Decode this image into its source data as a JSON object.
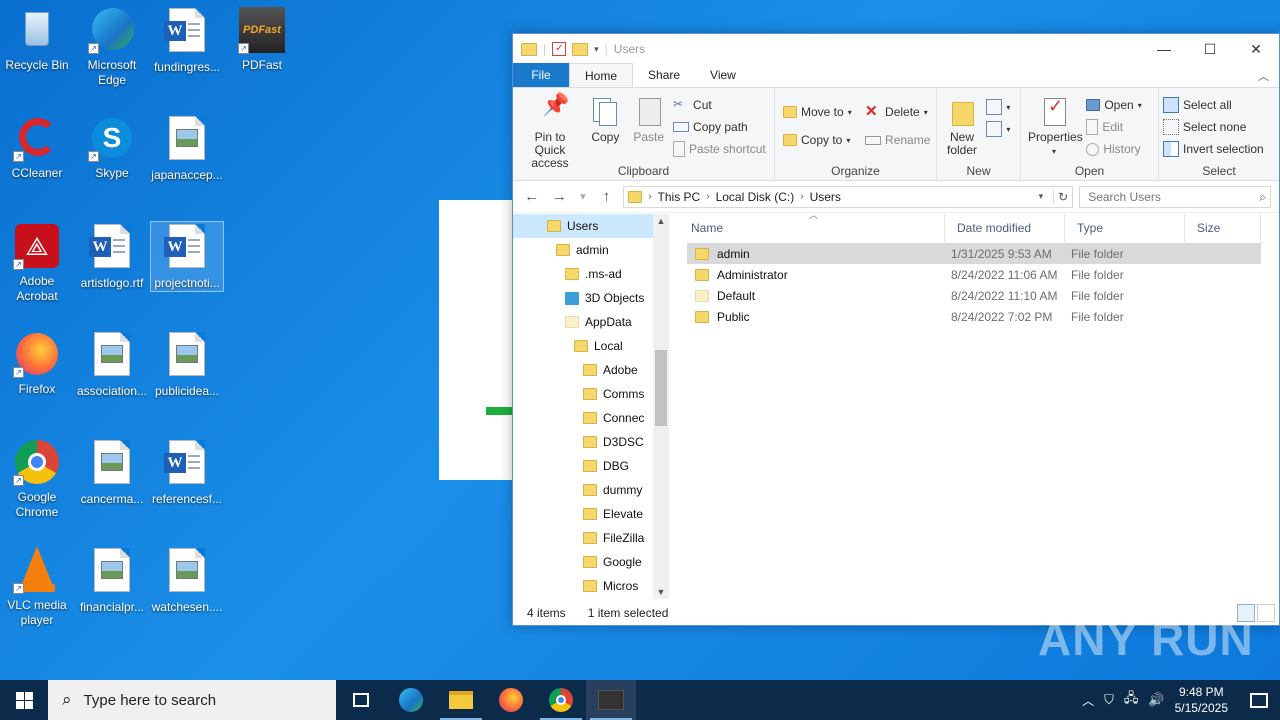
{
  "desktop": {
    "icons": [
      {
        "label": "Recycle Bin"
      },
      {
        "label": "Microsoft Edge"
      },
      {
        "label": "fundingres..."
      },
      {
        "label": "PDFast",
        "badge": "PDFast"
      },
      {
        "label": "CCleaner"
      },
      {
        "label": "Skype"
      },
      {
        "label": "japanaccep..."
      },
      {
        "label": "Adobe Acrobat"
      },
      {
        "label": "artistlogo.rtf"
      },
      {
        "label": "projectnoti..."
      },
      {
        "label": "Firefox"
      },
      {
        "label": "association..."
      },
      {
        "label": "publicidea..."
      },
      {
        "label": "Google Chrome"
      },
      {
        "label": "cancerma..."
      },
      {
        "label": "referencesf..."
      },
      {
        "label": "VLC media player"
      },
      {
        "label": "financialpr..."
      },
      {
        "label": "watchesen...."
      }
    ]
  },
  "explorer": {
    "title": "Users",
    "tabs": [
      "File",
      "Home",
      "Share",
      "View"
    ],
    "ribbon": {
      "clipboard": {
        "pin": "Pin to Quick access",
        "copy": "Copy",
        "paste": "Paste",
        "cut": "Cut",
        "copy_path": "Copy path",
        "paste_shortcut": "Paste shortcut",
        "label": "Clipboard"
      },
      "organize": {
        "move_to": "Move to",
        "copy_to": "Copy to",
        "delete": "Delete",
        "rename": "Rename",
        "label": "Organize"
      },
      "new": {
        "new_folder": "New folder",
        "label": "New"
      },
      "open": {
        "properties": "Properties",
        "open": "Open",
        "edit": "Edit",
        "history": "History",
        "label": "Open"
      },
      "select": {
        "select_all": "Select all",
        "select_none": "Select none",
        "invert": "Invert selection",
        "label": "Select"
      }
    },
    "address": {
      "crumbs": [
        "This PC",
        "Local Disk (C:)",
        "Users"
      ],
      "search_placeholder": "Search Users"
    },
    "nav_tree": [
      {
        "label": "Users",
        "indent": 1,
        "selected": true
      },
      {
        "label": "admin",
        "indent": 2
      },
      {
        "label": ".ms-ad",
        "indent": 3
      },
      {
        "label": "3D Objects",
        "indent": 3,
        "icon": "3d"
      },
      {
        "label": "AppData",
        "indent": 3,
        "icon": "pale"
      },
      {
        "label": "Local",
        "indent": 4
      },
      {
        "label": "Adobe",
        "indent": 5
      },
      {
        "label": "Comms",
        "indent": 5
      },
      {
        "label": "Connec",
        "indent": 5
      },
      {
        "label": "D3DSC",
        "indent": 5
      },
      {
        "label": "DBG",
        "indent": 5
      },
      {
        "label": "dummy",
        "indent": 5
      },
      {
        "label": "Elevate",
        "indent": 5
      },
      {
        "label": "FileZilla",
        "indent": 5
      },
      {
        "label": "Google",
        "indent": 5
      },
      {
        "label": "Micros",
        "indent": 5
      }
    ],
    "columns": [
      "Name",
      "Date modified",
      "Type",
      "Size"
    ],
    "files": [
      {
        "name": "admin",
        "date": "1/31/2025 9:53 AM",
        "type": "File folder",
        "selected": true
      },
      {
        "name": "Administrator",
        "date": "8/24/2022 11:06 AM",
        "type": "File folder"
      },
      {
        "name": "Default",
        "date": "8/24/2022 11:10 AM",
        "type": "File folder",
        "pale": true
      },
      {
        "name": "Public",
        "date": "8/24/2022 7:02 PM",
        "type": "File folder"
      }
    ],
    "status": {
      "count": "4 items",
      "selection": "1 item selected"
    }
  },
  "taskbar": {
    "search_placeholder": "Type here to search",
    "time": "9:48 PM",
    "date": "5/15/2025"
  },
  "watermark": "ANY RUN"
}
